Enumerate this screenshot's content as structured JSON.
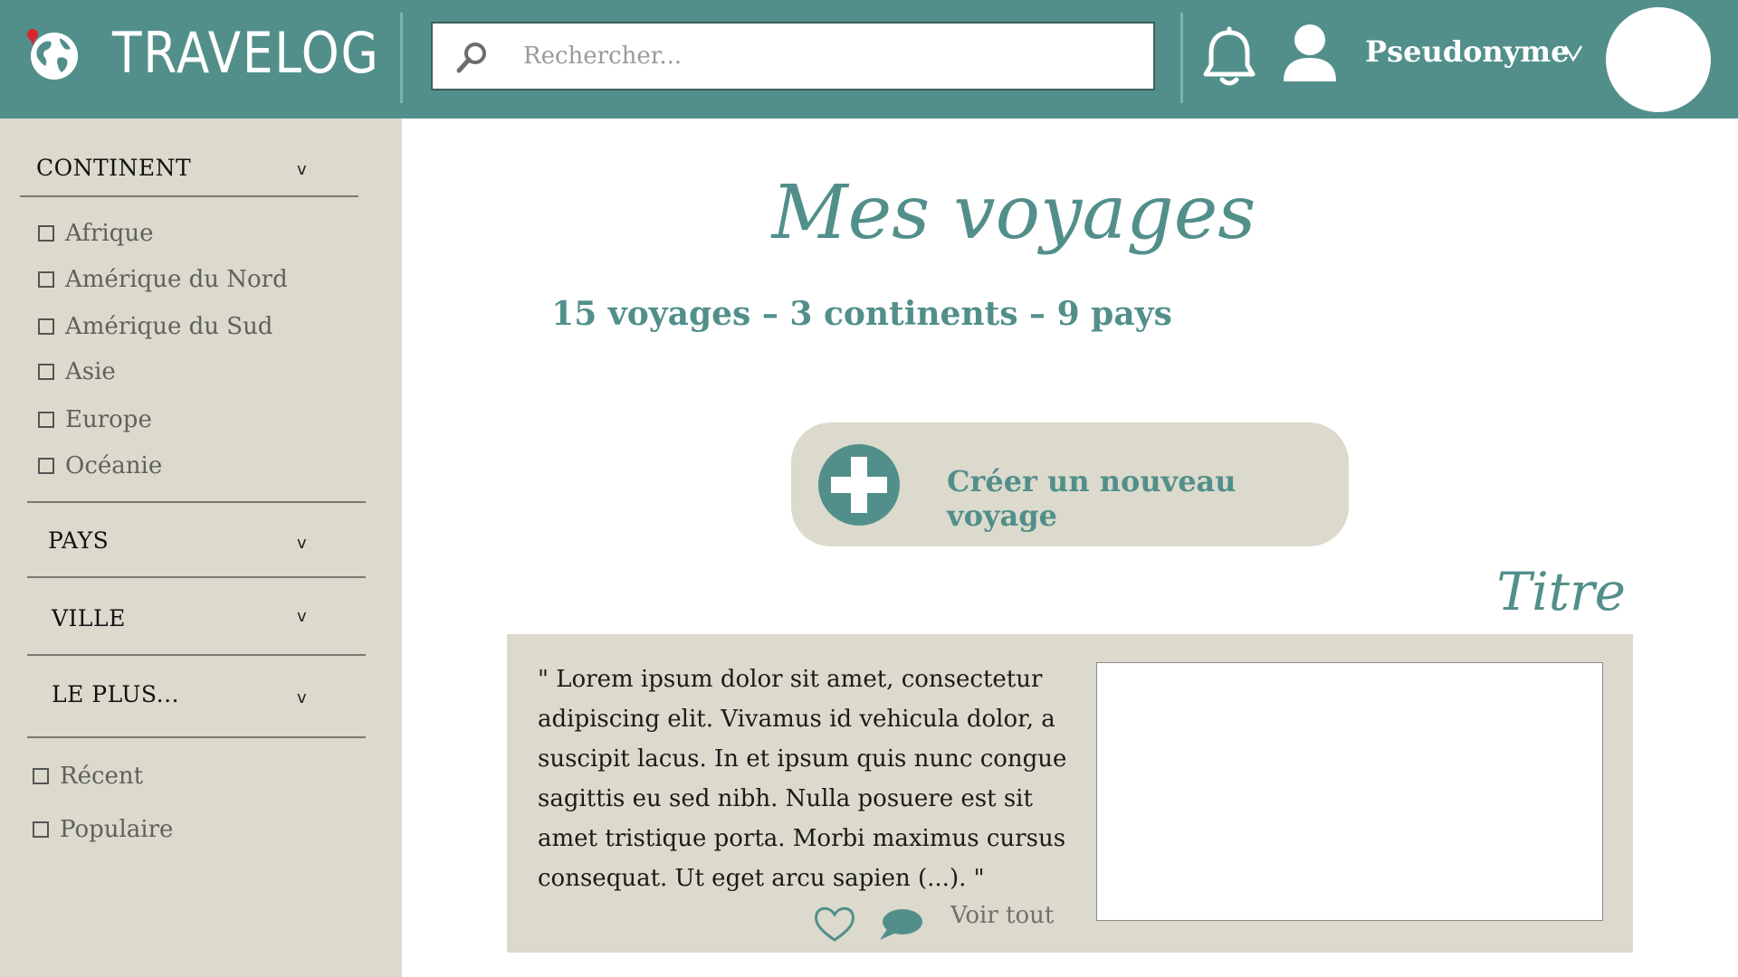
{
  "header": {
    "app_name": "TRAVELOG",
    "search": {
      "placeholder": "Rechercher...",
      "value": ""
    },
    "user_name": "Pseudonyme",
    "user_chevron": "v"
  },
  "sidebar": {
    "continent": {
      "label": "CONTINENT",
      "chevron": "v",
      "options": [
        "Afrique",
        "Amérique du Nord",
        "Amérique du Sud",
        "Asie",
        "Europe",
        "Océanie"
      ]
    },
    "pays": {
      "label": "PAYS",
      "chevron": "v"
    },
    "ville": {
      "label": "VILLE",
      "chevron": "v"
    },
    "le_plus": {
      "label": "LE PLUS...",
      "chevron": "v"
    },
    "sort_options": [
      "Récent",
      "Populaire"
    ]
  },
  "main": {
    "title": "Mes voyages",
    "stats": "15 voyages – 3 continents – 9 pays",
    "create_button": "Créer un nouveau voyage",
    "card": {
      "title": "Titre",
      "excerpt": "\" Lorem ipsum dolor sit amet, consectetur adipiscing elit. Vivamus id vehicula dolor, a suscipit lacus. In et ipsum quis nunc congue sagittis eu sed nibh. Nulla posuere est sit amet tristique porta. Morbi maximus cursus consequat. Ut eget arcu sapien (...). \"",
      "see_all": "Voir tout"
    }
  },
  "colors": {
    "accent": "#528f8b",
    "panel": "#dcdacc",
    "pin": "#d9252a"
  },
  "icons": [
    "globe-pin-icon",
    "search-icon",
    "bell-icon",
    "user-icon",
    "chevron-down-icon",
    "plus-icon",
    "heart-icon",
    "comment-icon"
  ]
}
